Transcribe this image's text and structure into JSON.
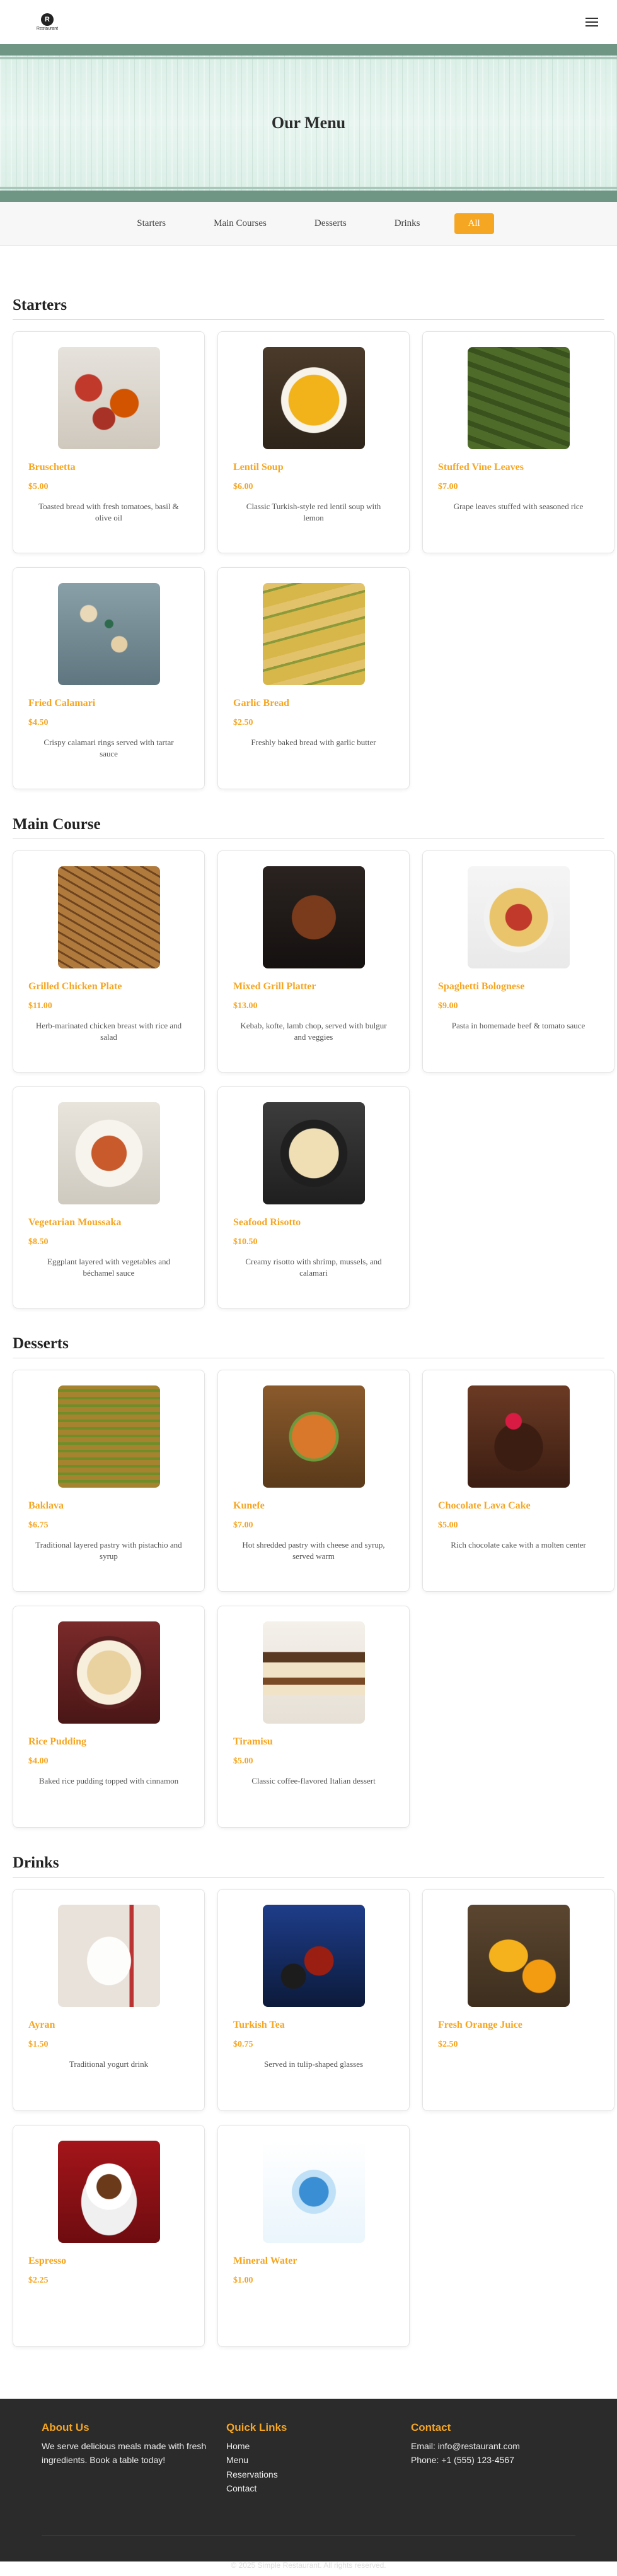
{
  "header": {
    "logo_mark": "R",
    "logo_text": "Restaurant"
  },
  "hero": {
    "title": "Our Menu"
  },
  "filters": [
    {
      "label": "Starters",
      "active": false
    },
    {
      "label": "Main Courses",
      "active": false
    },
    {
      "label": "Desserts",
      "active": false
    },
    {
      "label": "Drinks",
      "active": false
    },
    {
      "label": "All",
      "active": true
    }
  ],
  "colors": {
    "accent": "#f5a623",
    "footer_bg": "#2b2b2b",
    "hero_band": "#6f9585"
  },
  "sections": [
    {
      "title": "Starters",
      "items": [
        {
          "name": "Bruschetta",
          "price": "$5.00",
          "desc": "Toasted bread with fresh tomatoes, basil & olive oil",
          "image": "bruschetta-photo"
        },
        {
          "name": "Lentil Soup",
          "price": "$6.00",
          "desc": "Classic Turkish-style red lentil soup with lemon",
          "image": "lentil-soup-photo"
        },
        {
          "name": "Stuffed Vine Leaves",
          "price": "$7.00",
          "desc": "Grape leaves stuffed with seasoned rice",
          "image": "vine-leaves-photo"
        },
        {
          "name": "Fried Calamari",
          "price": "$4.50",
          "desc": "Crispy calamari rings served with tartar sauce",
          "image": "calamari-photo"
        },
        {
          "name": "Garlic Bread",
          "price": "$2.50",
          "desc": "Freshly baked bread with garlic butter",
          "image": "garlic-bread-photo"
        }
      ]
    },
    {
      "title": "Main Course",
      "items": [
        {
          "name": "Grilled Chicken Plate",
          "price": "$11.00",
          "desc": "Herb-marinated chicken breast with rice and salad",
          "image": "grilled-chicken-photo"
        },
        {
          "name": "Mixed Grill Platter",
          "price": "$13.00",
          "desc": "Kebab, kofte, lamb chop, served with bulgur and veggies",
          "image": "mixed-grill-photo"
        },
        {
          "name": "Spaghetti Bolognese",
          "price": "$9.00",
          "desc": "Pasta in homemade beef & tomato sauce",
          "image": "spaghetti-photo"
        },
        {
          "name": "Vegetarian Moussaka",
          "price": "$8.50",
          "desc": "Eggplant layered with vegetables and béchamel sauce",
          "image": "moussaka-photo"
        },
        {
          "name": "Seafood Risotto",
          "price": "$10.50",
          "desc": "Creamy risotto with shrimp, mussels, and calamari",
          "image": "risotto-photo"
        }
      ]
    },
    {
      "title": "Desserts",
      "items": [
        {
          "name": "Baklava",
          "price": "$6.75",
          "desc": "Traditional layered pastry with pistachio and syrup",
          "image": "baklava-photo"
        },
        {
          "name": "Kunefe",
          "price": "$7.00",
          "desc": "Hot shredded pastry with cheese and syrup, served warm",
          "image": "kunefe-photo"
        },
        {
          "name": "Chocolate Lava Cake",
          "price": "$5.00",
          "desc": "Rich chocolate cake with a molten center",
          "image": "lava-cake-photo"
        },
        {
          "name": "Rice Pudding",
          "price": "$4.00",
          "desc": "Baked rice pudding topped with cinnamon",
          "image": "rice-pudding-photo"
        },
        {
          "name": "Tiramisu",
          "price": "$5.00",
          "desc": "Classic coffee-flavored Italian dessert",
          "image": "tiramisu-photo"
        }
      ]
    },
    {
      "title": "Drinks",
      "items": [
        {
          "name": "Ayran",
          "price": "$1.50",
          "desc": "Traditional yogurt drink",
          "image": "ayran-photo"
        },
        {
          "name": "Turkish Tea",
          "price": "$0.75",
          "desc": "Served in tulip-shaped glasses",
          "image": "turkish-tea-photo"
        },
        {
          "name": "Fresh Orange Juice",
          "price": "$2.50",
          "desc": "",
          "image": "orange-juice-photo"
        },
        {
          "name": "Espresso",
          "price": "$2.25",
          "desc": "",
          "image": "espresso-photo"
        },
        {
          "name": "Mineral Water",
          "price": "$1.00",
          "desc": "",
          "image": "mineral-water-photo"
        }
      ]
    }
  ],
  "footer": {
    "about_title": "About Us",
    "about_text": "We serve delicious meals made with fresh ingredients. Book a table today!",
    "links_title": "Quick Links",
    "links": [
      "Home",
      "Menu",
      "Reservations",
      "Contact"
    ],
    "contact_title": "Contact",
    "email": "Email: info@restaurant.com",
    "phone": "Phone: +1 (555) 123-4567",
    "copyright": "© 2025 Simple Restaurant. All rights reserved."
  }
}
